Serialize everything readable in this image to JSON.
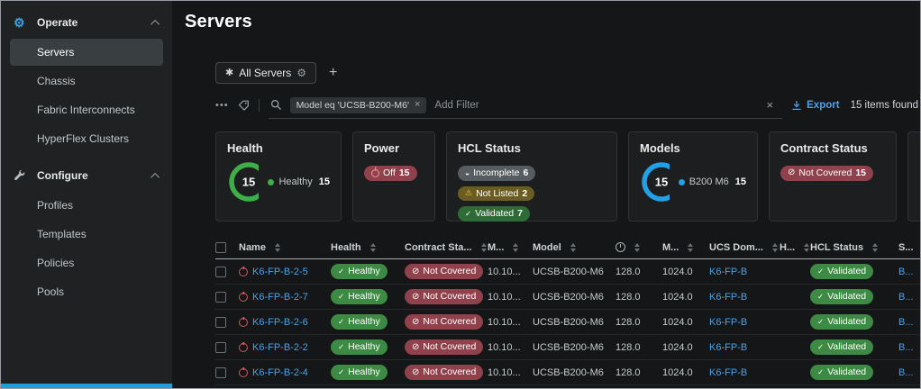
{
  "icons": {
    "operate": "⚙",
    "gear": "⚙",
    "asterisk": "✱",
    "plus": "+",
    "ellipsis": "•••",
    "close": "×",
    "check": "✓",
    "not_covered": "⊘",
    "warning": "⚠",
    "incomplete": "◒"
  },
  "sidebar": {
    "sections": [
      {
        "label": "Operate",
        "items": [
          "Servers",
          "Chassis",
          "Fabric Interconnects",
          "HyperFlex Clusters"
        ]
      },
      {
        "label": "Configure",
        "items": [
          "Profiles",
          "Templates",
          "Policies",
          "Pools"
        ]
      }
    ],
    "active_item": "Servers"
  },
  "header": {
    "title": "Servers"
  },
  "tabbar": {
    "active_tab": "All Servers"
  },
  "filterbar": {
    "filter_chip": "Model eq 'UCSB-B200-M6'",
    "add_filter_placeholder": "Add Filter",
    "export_label": "Export",
    "items_found": "15 items found"
  },
  "cards": {
    "health": {
      "title": "Health",
      "total": "15",
      "ring_color": "#3fae49",
      "legend": [
        {
          "label": "Healthy",
          "value": "15",
          "color": "#3fae49"
        }
      ]
    },
    "power": {
      "title": "Power",
      "badge": {
        "label": "Off",
        "value": "15"
      }
    },
    "hcl": {
      "title": "HCL Status",
      "badges": [
        {
          "label": "Incomplete",
          "value": "6"
        },
        {
          "label": "Not Listed",
          "value": "2"
        },
        {
          "label": "Validated",
          "value": "7"
        }
      ]
    },
    "models": {
      "title": "Models",
      "total": "15",
      "ring_color": "#22a0e8",
      "legend": [
        {
          "label": "B200 M6",
          "value": "15",
          "color": "#22a0e8"
        }
      ]
    },
    "contract": {
      "title": "Contract Status",
      "badge": {
        "label": "Not Covered",
        "value": "15"
      }
    }
  },
  "table": {
    "columns": [
      "Name",
      "Health",
      "Contract Sta...",
      "M...",
      "Model",
      "",
      "M...",
      "UCS Dom...",
      "H...",
      "HCL Status",
      "S..."
    ],
    "rows": [
      {
        "name": "K6-FP-B-2-5",
        "health": "Healthy",
        "contract": "Not Covered",
        "mgmt": "10.10...",
        "model": "UCSB-B200-M6",
        "cpu": "128.0",
        "mem": "1024.0",
        "ucs_domain": "K6-FP-B",
        "hcl": "Validated",
        "s": "B..."
      },
      {
        "name": "K6-FP-B-2-7",
        "health": "Healthy",
        "contract": "Not Covered",
        "mgmt": "10.10...",
        "model": "UCSB-B200-M6",
        "cpu": "128.0",
        "mem": "1024.0",
        "ucs_domain": "K6-FP-B",
        "hcl": "Validated",
        "s": "B..."
      },
      {
        "name": "K6-FP-B-2-6",
        "health": "Healthy",
        "contract": "Not Covered",
        "mgmt": "10.10...",
        "model": "UCSB-B200-M6",
        "cpu": "128.0",
        "mem": "1024.0",
        "ucs_domain": "K6-FP-B",
        "hcl": "Validated",
        "s": "B..."
      },
      {
        "name": "K6-FP-B-2-2",
        "health": "Healthy",
        "contract": "Not Covered",
        "mgmt": "10.10...",
        "model": "UCSB-B200-M6",
        "cpu": "128.0",
        "mem": "1024.0",
        "ucs_domain": "K6-FP-B",
        "hcl": "Validated",
        "s": "B..."
      },
      {
        "name": "K6-FP-B-2-4",
        "health": "Healthy",
        "contract": "Not Covered",
        "mgmt": "10.10...",
        "model": "UCSB-B200-M6",
        "cpu": "128.0",
        "mem": "1024.0",
        "ucs_domain": "K6-FP-B",
        "hcl": "Validated",
        "s": "B..."
      }
    ]
  }
}
